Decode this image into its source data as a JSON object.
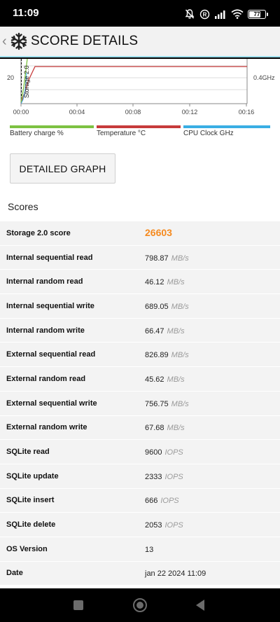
{
  "status_bar": {
    "time": "11:09",
    "battery_level": 77,
    "icons": [
      "mute-icon",
      "registered-icon",
      "signal-icon",
      "wifi-icon",
      "battery-icon"
    ]
  },
  "header": {
    "title": "SCORE DETAILS",
    "back_icon": "chevron-left-icon",
    "app_icon": "snowflake-icon"
  },
  "chart": {
    "y_tick": "20",
    "right_tick": "0.4GHz",
    "x_ticks": [
      "00:00",
      "00:04",
      "00:08",
      "00:12",
      "00:16"
    ],
    "marker_label": "Storage 2.0",
    "legend": [
      {
        "label": "Battery charge %",
        "color": "#7dc242"
      },
      {
        "label": "Temperature °C",
        "color": "#c73b3b"
      },
      {
        "label": "CPU Clock GHz",
        "color": "#3aaee4"
      }
    ]
  },
  "detailed_graph_button": "DETAILED GRAPH",
  "scores_section_title": "Scores",
  "scores": [
    {
      "label": "Storage 2.0 score",
      "value": "26603",
      "unit": "",
      "highlight": true
    },
    {
      "label": "Internal sequential read",
      "value": "798.87",
      "unit": "MB/s"
    },
    {
      "label": "Internal random read",
      "value": "46.12",
      "unit": "MB/s"
    },
    {
      "label": "Internal sequential write",
      "value": "689.05",
      "unit": "MB/s"
    },
    {
      "label": "Internal random write",
      "value": "66.47",
      "unit": "MB/s"
    },
    {
      "label": "External sequential read",
      "value": "826.89",
      "unit": "MB/s"
    },
    {
      "label": "External random read",
      "value": "45.62",
      "unit": "MB/s"
    },
    {
      "label": "External sequential write",
      "value": "756.75",
      "unit": "MB/s"
    },
    {
      "label": "External random write",
      "value": "67.68",
      "unit": "MB/s"
    },
    {
      "label": "SQLite read",
      "value": "9600",
      "unit": "IOPS"
    },
    {
      "label": "SQLite update",
      "value": "2333",
      "unit": "IOPS"
    },
    {
      "label": "SQLite insert",
      "value": "666",
      "unit": "IOPS"
    },
    {
      "label": "SQLite delete",
      "value": "2053",
      "unit": "IOPS"
    },
    {
      "label": "OS Version",
      "value": "13",
      "unit": ""
    },
    {
      "label": "Date",
      "value": "jan 22 2024 11:09",
      "unit": ""
    }
  ],
  "nav_bar": {
    "buttons": [
      "recents-square-icon",
      "home-circle-icon",
      "back-triangle-icon"
    ]
  }
}
